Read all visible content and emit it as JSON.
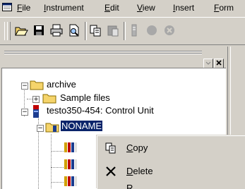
{
  "menubar": {
    "items": [
      {
        "label": "File",
        "mnemonic": "F",
        "rest": "ile"
      },
      {
        "label": "Instrument",
        "mnemonic": "I",
        "rest": "nstrument"
      },
      {
        "label": "Edit",
        "mnemonic": "E",
        "rest": "dit"
      },
      {
        "label": "View",
        "mnemonic": "V",
        "rest": "iew"
      },
      {
        "label": "Insert",
        "mnemonic": "I",
        "rest": "nsert"
      },
      {
        "label": "Form",
        "mnemonic": "F",
        "rest": "orm"
      }
    ]
  },
  "toolbar": {
    "buttons": [
      "open-folder-icon",
      "save-icon",
      "print-icon",
      "print-preview-icon",
      "copy-icon",
      "paste-icon",
      "instrument-icon",
      "record-icon",
      "stop-icon"
    ]
  },
  "tree": {
    "nodes": [
      {
        "label": "archive",
        "expander": "−",
        "icon": "folder-icon"
      },
      {
        "label": "Sample files",
        "expander": "+",
        "icon": "folder-icon"
      },
      {
        "label": "testo350-454: Control Unit",
        "expander": "−",
        "icon": "instrument-icon"
      },
      {
        "label": "NONAME",
        "expander": "−",
        "icon": "folder-icon",
        "selected": true
      }
    ]
  },
  "context_menu": {
    "items": [
      {
        "label": "Copy",
        "mnemonic": "C",
        "rest": "opy",
        "icon": "copy-icon"
      },
      {
        "label": "Delete",
        "mnemonic": "D",
        "rest": "elete",
        "icon": "delete-icon"
      },
      {
        "label": "R",
        "mnemonic": "",
        "rest": "R",
        "icon": ""
      }
    ]
  },
  "colors": {
    "chrome": "#d4d0c8",
    "selection": "#0a246a",
    "folder": "#f5d46b"
  }
}
